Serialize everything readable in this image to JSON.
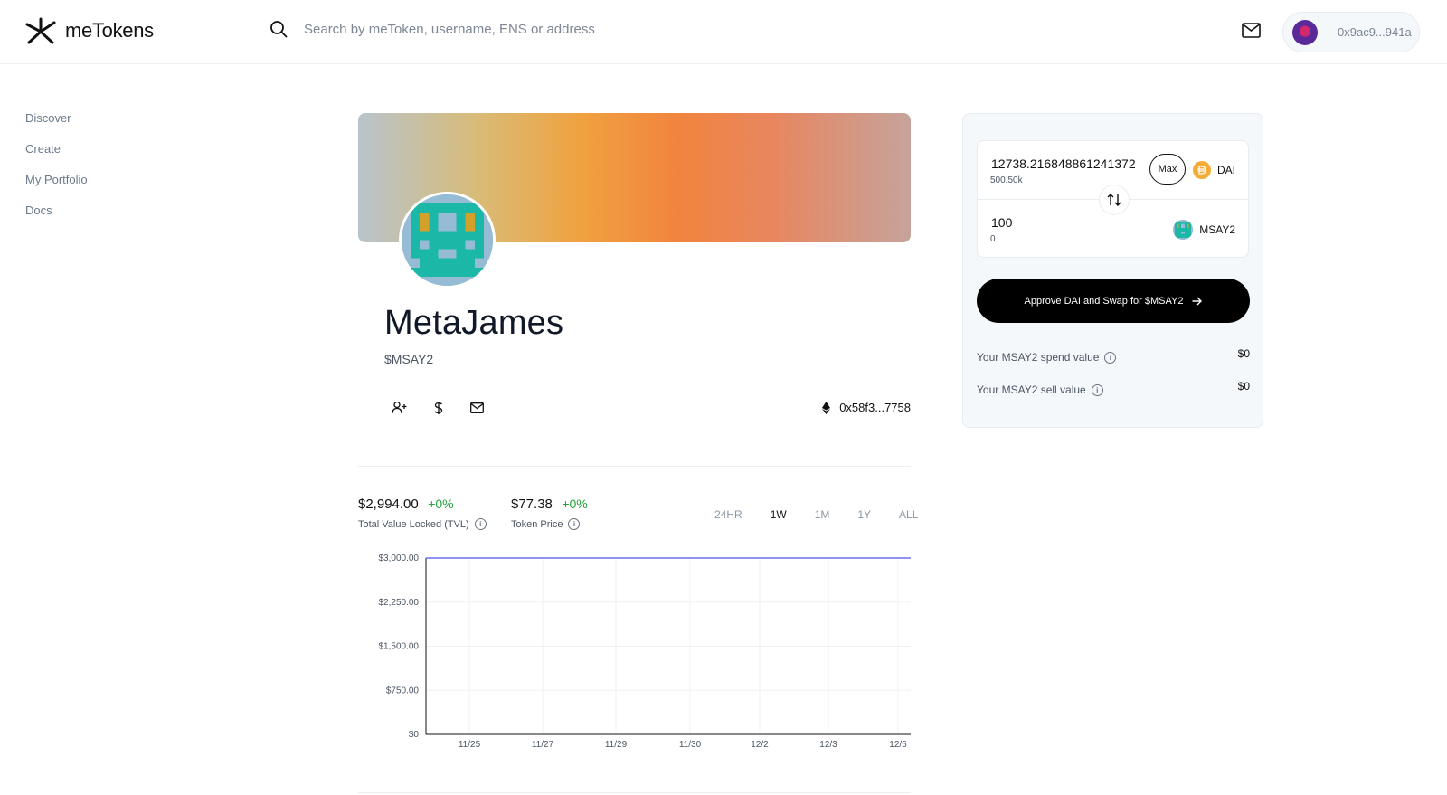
{
  "brand": {
    "name": "meTokens"
  },
  "search": {
    "placeholder": "Search by meToken, username, ENS or address"
  },
  "wallet": {
    "address": "0x9ac9...941a"
  },
  "sidebar": {
    "items": [
      {
        "label": "Discover"
      },
      {
        "label": "Create"
      },
      {
        "label": "My Portfolio"
      },
      {
        "label": "Docs"
      }
    ]
  },
  "profile": {
    "name": "MetaJames",
    "ticker": "$MSAY2",
    "contract": "0x58f3...7758"
  },
  "stats": {
    "tvl": {
      "value": "$2,994.00",
      "change": "+0%",
      "label": "Total Value Locked (TVL)"
    },
    "price": {
      "value": "$77.38",
      "change": "+0%",
      "label": "Token Price"
    }
  },
  "ranges": [
    {
      "label": "24HR",
      "active": false
    },
    {
      "label": "1W",
      "active": true
    },
    {
      "label": "1M",
      "active": false
    },
    {
      "label": "1Y",
      "active": false
    },
    {
      "label": "ALL",
      "active": false
    }
  ],
  "chart_data": {
    "type": "line",
    "x": [
      "11/25",
      "11/27",
      "11/29",
      "11/30",
      "12/2",
      "12/3",
      "12/5"
    ],
    "y_ticks": [
      "$0",
      "$750.00",
      "$1,500.00",
      "$2,250.00",
      "$3,000.00"
    ],
    "ylim": [
      0,
      3000
    ],
    "series": [
      {
        "values": [
          3000,
          3000,
          3000,
          3000,
          3000,
          3000,
          3000
        ]
      }
    ],
    "line_color": "#6b6ff0",
    "grid": true
  },
  "swap": {
    "from": {
      "amount": "12738.216848861241372",
      "balance": "500.50k",
      "token": "DAI",
      "max_label": "Max"
    },
    "to": {
      "amount": "100",
      "balance": "0",
      "token": "MSAY2"
    },
    "approve_label": "Approve DAI and Swap for $MSAY2",
    "spend_label": "Your MSAY2 spend value",
    "spend_value": "$0",
    "sell_label": "Your MSAY2 sell value",
    "sell_value": "$0"
  },
  "colors": {
    "positive": "#22a33a",
    "button": "#000000",
    "accent_line": "#6b6ff0"
  }
}
